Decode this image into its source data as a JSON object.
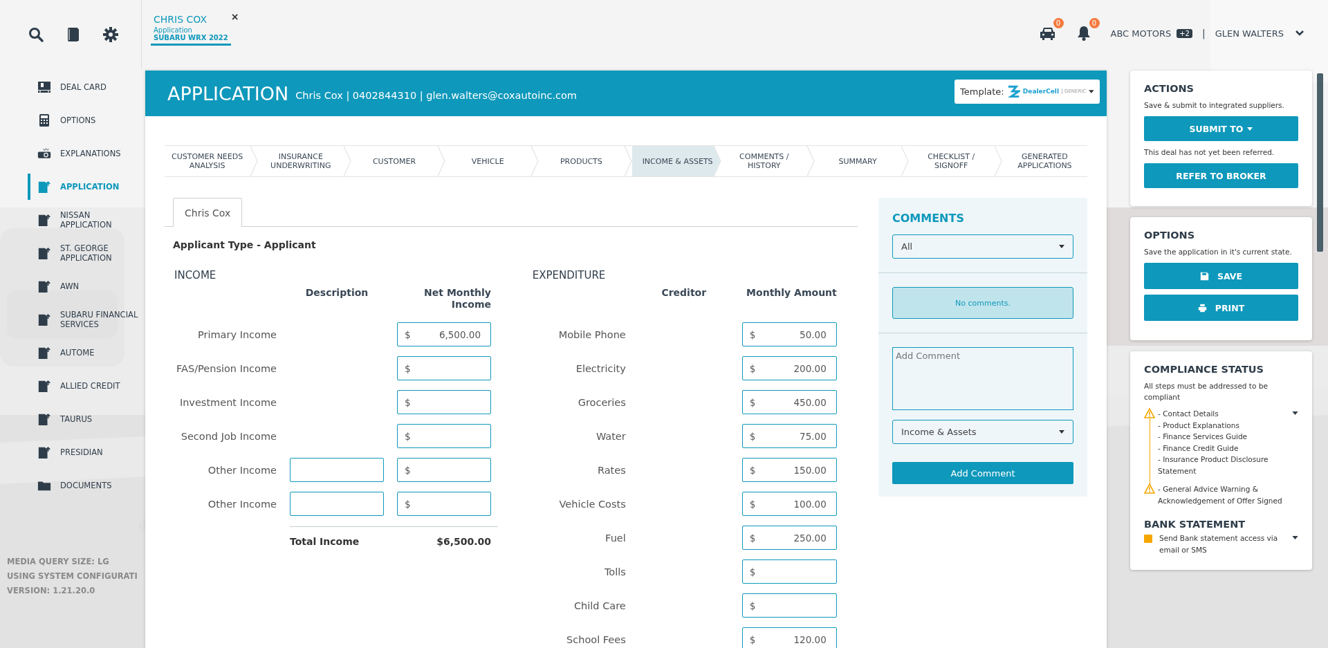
{
  "topbar": {
    "tab": {
      "name": "CHRIS COX",
      "type": "Application",
      "vehicle": "SUBARU WRX 2022",
      "close": "×",
      "selected": true
    },
    "cart_count": "0",
    "notification_count": "0",
    "dealer": "ABC MOTORS",
    "dealer_badge": "+2",
    "separator": "|",
    "user": "GLEN WALTERS"
  },
  "sidebar": {
    "items": [
      {
        "label": "DEAL CARD",
        "kind": "card",
        "selected": false
      },
      {
        "label": "OPTIONS",
        "kind": "calculator",
        "selected": false
      },
      {
        "label": "EXPLANATIONS",
        "kind": "projector",
        "selected": false
      },
      {
        "label": "APPLICATION",
        "kind": "document",
        "selected": true
      },
      {
        "label": "NISSAN APPLICATION",
        "kind": "document",
        "selected": false
      },
      {
        "label": "ST. GEORGE APPLICATION",
        "kind": "document",
        "selected": false
      },
      {
        "label": "AWN",
        "kind": "document",
        "selected": false
      },
      {
        "label": "SUBARU FINANCIAL SERVICES",
        "kind": "document",
        "selected": false
      },
      {
        "label": "AUTOME",
        "kind": "document",
        "selected": false
      },
      {
        "label": "ALLIED CREDIT",
        "kind": "document",
        "selected": false
      },
      {
        "label": "TAURUS",
        "kind": "document",
        "selected": false
      },
      {
        "label": "PRESIDIAN",
        "kind": "document",
        "selected": false
      },
      {
        "label": "DOCUMENTS",
        "kind": "folder",
        "selected": false
      }
    ],
    "footer": [
      "MEDIA QUERY SIZE: LG",
      "USING SYSTEM CONFIGURATI",
      "VERSION: 1.21.20.0"
    ]
  },
  "header": {
    "title": "APPLICATION",
    "details": "Chris Cox | 0402844310 | glen.walters@coxautoinc.com",
    "template_label": "Template:",
    "template_logo": "DealerCell",
    "template_tag": "GENERIC"
  },
  "steps": [
    {
      "label": "CUSTOMER NEEDS ANALYSIS",
      "selected": false
    },
    {
      "label": "INSURANCE UNDERWRITING",
      "selected": false
    },
    {
      "label": "CUSTOMER",
      "selected": false
    },
    {
      "label": "VEHICLE",
      "selected": false
    },
    {
      "label": "PRODUCTS",
      "selected": false
    },
    {
      "label": "INCOME & ASSETS",
      "selected": true
    },
    {
      "label": "COMMENTS / HISTORY",
      "selected": false
    },
    {
      "label": "SUMMARY",
      "selected": false
    },
    {
      "label": "CHECKLIST / SIGNOFF",
      "selected": false
    },
    {
      "label": "GENERATED APPLICATIONS",
      "selected": false
    }
  ],
  "applicant_tabs": [
    {
      "label": "Chris Cox",
      "selected": true
    }
  ],
  "applicant_type": "Applicant Type - Applicant",
  "income": {
    "title": "INCOME",
    "columns": [
      "Description",
      "Net Monthly Income"
    ],
    "rows": [
      {
        "label": "Primary Income",
        "kind": "plain",
        "currency": "$",
        "amount": "6,500.00"
      },
      {
        "label": "FAS/Pension Income",
        "kind": "plain",
        "currency": "$"
      },
      {
        "label": "Investment Income",
        "kind": "plain",
        "currency": "$"
      },
      {
        "label": "Second Job Income",
        "kind": "plain",
        "currency": "$"
      },
      {
        "label": "Other Income",
        "kind": "described",
        "currency": "$"
      },
      {
        "label": "Other Income",
        "kind": "described",
        "currency": "$"
      }
    ],
    "total_label": "Total Income",
    "total": "$6,500.00"
  },
  "expenditure": {
    "title": "EXPENDITURE",
    "columns": [
      "Creditor",
      "Monthly Amount"
    ],
    "rows": [
      {
        "label": "Mobile Phone",
        "currency": "$",
        "amount": "50.00"
      },
      {
        "label": "Electricity",
        "currency": "$",
        "amount": "200.00"
      },
      {
        "label": "Groceries",
        "currency": "$",
        "amount": "450.00"
      },
      {
        "label": "Water",
        "currency": "$",
        "amount": "75.00"
      },
      {
        "label": "Rates",
        "currency": "$",
        "amount": "150.00"
      },
      {
        "label": "Vehicle Costs",
        "currency": "$",
        "amount": "100.00"
      },
      {
        "label": "Fuel",
        "currency": "$",
        "amount": "250.00"
      },
      {
        "label": "Tolls",
        "currency": "$"
      },
      {
        "label": "Child Care",
        "currency": "$"
      },
      {
        "label": "School Fees",
        "currency": "$",
        "amount": "120.00"
      }
    ]
  },
  "comments": {
    "title": "COMMENTS",
    "filter": "All",
    "empty": "No comments.",
    "placeholder": "Add Comment",
    "section": "Income & Assets",
    "button": "Add Comment"
  },
  "actions": {
    "title": "ACTIONS",
    "text": "Save & submit to integrated suppliers.",
    "submit": "SUBMIT TO",
    "note": "This deal has not yet been referred.",
    "refer": "REFER TO BROKER"
  },
  "options": {
    "title": "OPTIONS",
    "text": "Save the application in it's current state.",
    "save": "SAVE",
    "print": "PRINT"
  },
  "compliance": {
    "title": "COMPLIANCE STATUS",
    "text": "All steps must be addressed to be compliant",
    "groups": [
      {
        "lines": [
          "- Contact Details",
          "- Product Explanations",
          "- Finance Services Guide",
          "- Finance Credit Guide",
          "- Insurance Product Disclosure Statement"
        ]
      },
      {
        "lines": [
          "- General Advice Warning & Acknowledgement of Offer Signed"
        ]
      }
    ],
    "bank_title": "BANK STATEMENT",
    "bank_text": "Send Bank statement access via email or SMS"
  }
}
